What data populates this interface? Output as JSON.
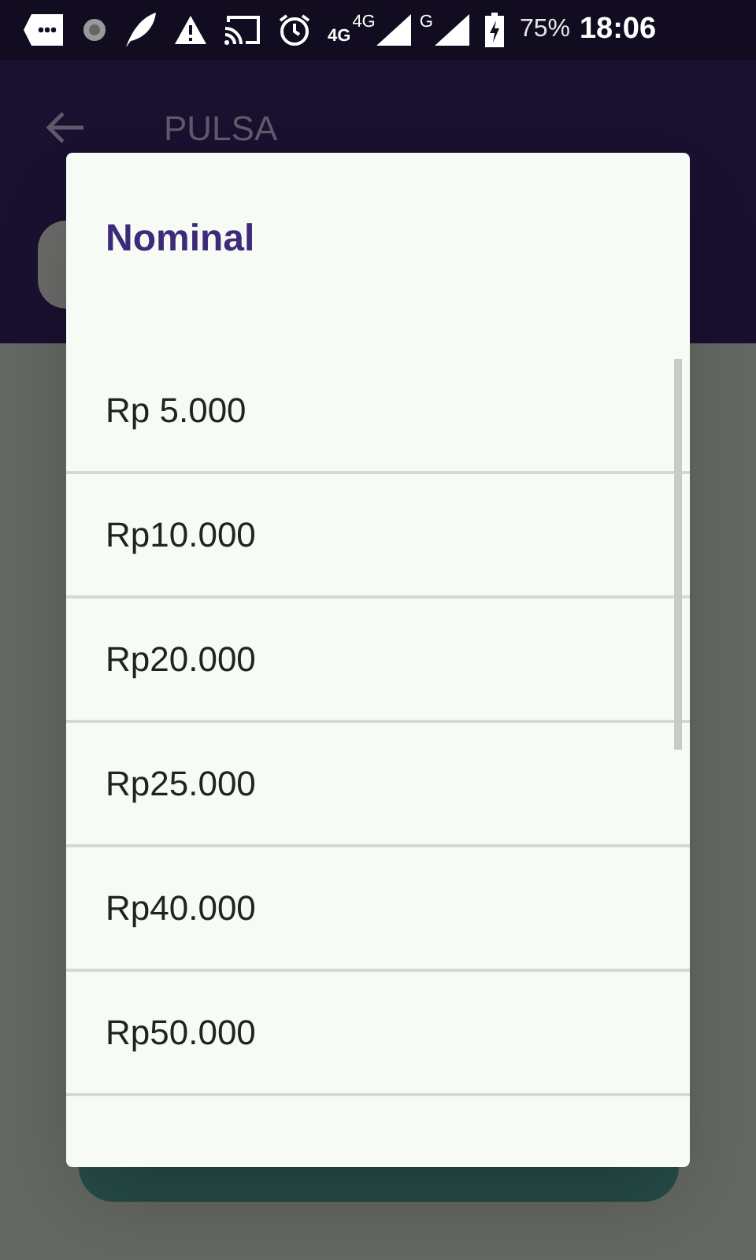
{
  "status_bar": {
    "data_type": "4G",
    "sim1_network": "4G",
    "sim2_network": "G",
    "battery": "75%",
    "time": "18:06"
  },
  "app_bar": {
    "title": "PULSA"
  },
  "dialog": {
    "title": "Nominal",
    "items": [
      {
        "label": "Rp 5.000"
      },
      {
        "label": "Rp10.000"
      },
      {
        "label": "Rp20.000"
      },
      {
        "label": "Rp25.000"
      },
      {
        "label": "Rp40.000"
      },
      {
        "label": "Rp50.000"
      }
    ]
  }
}
